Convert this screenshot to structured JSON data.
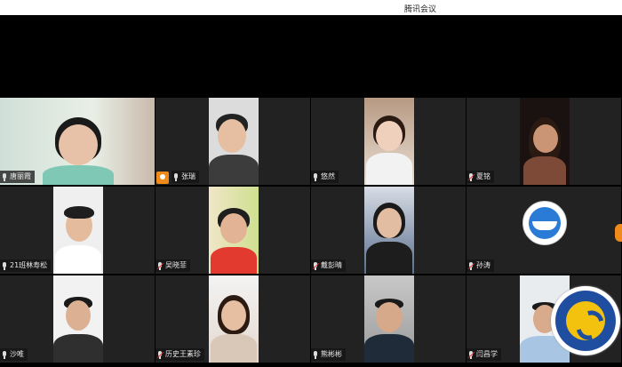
{
  "window": {
    "title": "腾讯会议"
  },
  "participants": [
    {
      "name": "唐丽霞",
      "mic": "on"
    },
    {
      "name": "张瑞",
      "mic": "on"
    },
    {
      "name": "悠然",
      "mic": "on"
    },
    {
      "name": "夏铭",
      "mic": "muted"
    },
    {
      "name": "21班林寿松",
      "mic": "on"
    },
    {
      "name": "吴晓菲",
      "mic": "muted"
    },
    {
      "name": "戴彭晴",
      "mic": "muted"
    },
    {
      "name": "孙涛",
      "mic": "muted"
    },
    {
      "name": "沙唯",
      "mic": "on"
    },
    {
      "name": "历史王素珍",
      "mic": "muted"
    },
    {
      "name": "熊彬彬",
      "mic": "on"
    },
    {
      "name": "闫昌学",
      "mic": "muted"
    }
  ],
  "watermark": {
    "text": "合肥市第七中学",
    "subtext": "HEFEI NO.7 HIGH SCHOOL"
  },
  "colors": {
    "background": "#000000",
    "tile": "#222222",
    "accent": "#f08a1a",
    "seal_blue": "#1f4ea1",
    "seal_gold": "#f3c20f"
  }
}
